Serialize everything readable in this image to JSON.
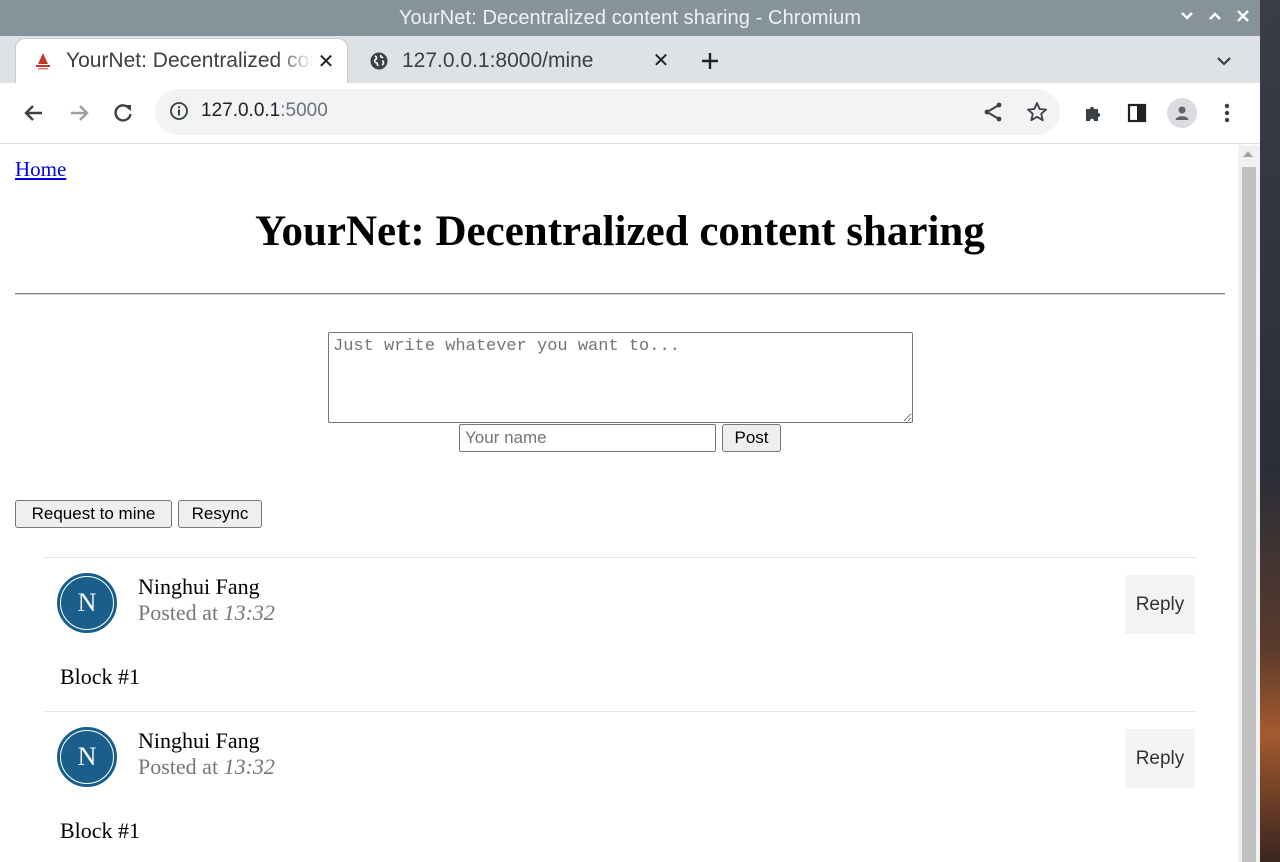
{
  "window": {
    "title": "YourNet: Decentralized content sharing - Chromium"
  },
  "tabs": [
    {
      "label": "YourNet: Decentralized content sharing",
      "favicon": "yournet-logo-icon",
      "active": true
    },
    {
      "label": "127.0.0.1:8000/mine",
      "favicon": "globe-icon",
      "active": false
    }
  ],
  "omnibox": {
    "host": "127.0.0.1",
    "port": ":5000"
  },
  "page": {
    "home_link": "Home",
    "title": "YourNet: Decentralized content sharing",
    "post_placeholder": "Just write whatever you want to...",
    "name_placeholder": "Your name",
    "post_button": "Post",
    "mine_button": "Request to mine",
    "resync_button": "Resync"
  },
  "posts": [
    {
      "initial": "N",
      "author": "Ninghui Fang",
      "posted_prefix": "Posted at",
      "time": "13:32",
      "content": "Block #1",
      "reply_label": "Reply"
    },
    {
      "initial": "N",
      "author": "Ninghui Fang",
      "posted_prefix": "Posted at",
      "time": "13:32",
      "content": "Block #1",
      "reply_label": "Reply"
    }
  ],
  "colors": {
    "titlebar": "#87939b",
    "tabstrip": "#dee1e6",
    "avatar": "#1a5f8c",
    "link": "#0000ee"
  }
}
